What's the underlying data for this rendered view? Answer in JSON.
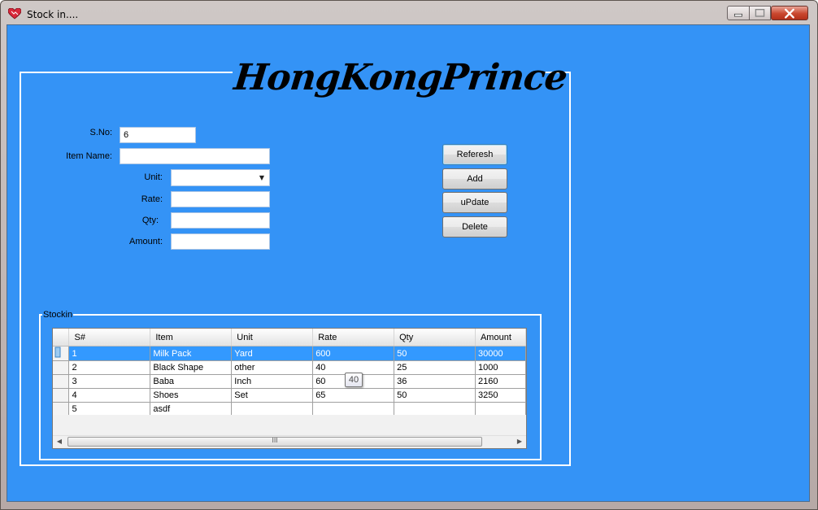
{
  "window": {
    "title": "Stock in...."
  },
  "logo": {
    "text": "HongKongPrince"
  },
  "form": {
    "sno_label": "S.No:",
    "sno_value": "6",
    "item_name_label": "Item Name:",
    "item_name_value": "",
    "unit_label": "Unit:",
    "unit_value": "",
    "rate_label": "Rate:",
    "rate_value": "",
    "qty_label": "Qty:",
    "qty_value": "",
    "amount_label": "Amount:",
    "amount_value": ""
  },
  "buttons": {
    "refresh": "Referesh",
    "add": "Add",
    "update": "uPdate",
    "delete": "Delete"
  },
  "stock_group": {
    "title": "Stockin",
    "columns": [
      "S#",
      "Item",
      "Unit",
      "Rate",
      "Qty",
      "Amount"
    ],
    "rows": [
      [
        "1",
        "Milk Pack",
        "Yard",
        "600",
        "50",
        "30000"
      ],
      [
        "2",
        "Black Shape",
        "other",
        "40",
        "25",
        "1000"
      ],
      [
        "3",
        "Baba",
        "Inch",
        "60",
        "36",
        "2160"
      ],
      [
        "4",
        "Shoes",
        "Set",
        "65",
        "50",
        "3250"
      ],
      [
        "5",
        "asdf",
        "",
        "",
        "",
        ""
      ]
    ],
    "selected_row": 0,
    "scroll_grip": "III"
  },
  "tooltip": {
    "text": "40"
  },
  "colors": {
    "client_bg": "#3493f6",
    "selection": "#3399ff"
  }
}
